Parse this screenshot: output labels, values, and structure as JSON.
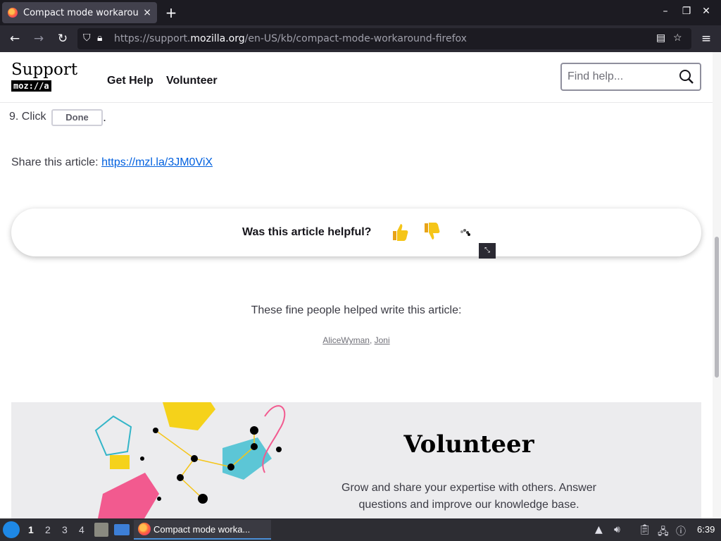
{
  "browser": {
    "tab_title": "Compact mode workaround",
    "tab_close": "×",
    "new_tab": "+",
    "url_prefix": "https://support.",
    "url_host": "mozilla.org",
    "url_path": "/en-US/kb/compact-mode-workaround-firefox",
    "window_controls": [
      "–",
      "❐",
      "✕"
    ]
  },
  "site": {
    "logo_word": "Support",
    "logo_mozilla": "moz://a",
    "nav": [
      "Get Help",
      "Volunteer"
    ],
    "search_placeholder": "Find help..."
  },
  "article": {
    "step_text": "9. Click",
    "done_button": "Done",
    "step_end": ".",
    "share_label": "Share this article:",
    "share_link": "https://mzl.la/3JM0ViX",
    "helpful_question": "Was this article helpful?",
    "contributors_heading": "These fine people helped write this article:",
    "contributors": [
      "AliceWyman",
      "Joni"
    ],
    "contributors_sep": ","
  },
  "volunteer": {
    "title": "Volunteer",
    "description": "Grow and share your expertise with others. Answer questions and improve our knowledge base."
  },
  "taskbar": {
    "workspaces": [
      "1",
      "2",
      "3",
      "4"
    ],
    "active_app": "Compact mode worka...",
    "clock": "6:39"
  },
  "colors": {
    "link": "#0060df",
    "chrome_dark": "#1c1b22",
    "thumbs": "#f5c518"
  }
}
